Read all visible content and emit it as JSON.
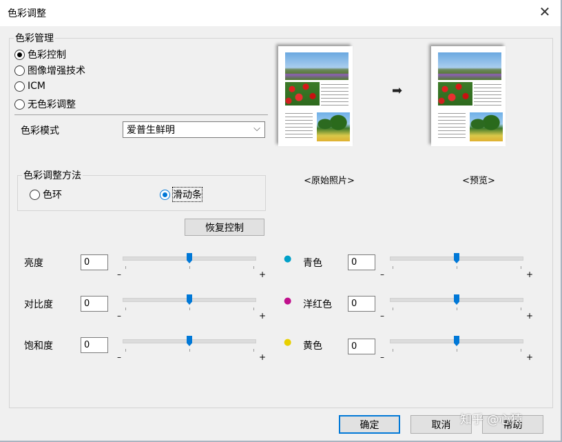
{
  "window": {
    "title": "色彩调整",
    "close_glyph": "✕"
  },
  "color_management": {
    "label": "色彩管理",
    "options": [
      {
        "label": "色彩控制",
        "checked": true
      },
      {
        "label": "图像增强技术",
        "checked": false
      },
      {
        "label": "ICM",
        "checked": false
      },
      {
        "label": "无色彩调整",
        "checked": false
      }
    ]
  },
  "color_mode": {
    "label": "色彩模式",
    "value": "爱普生鲜明",
    "chevron": "⌵"
  },
  "adjust_method": {
    "label": "色彩调整方法",
    "options": [
      {
        "label": "色环",
        "checked": false
      },
      {
        "label": "滑动条",
        "checked": true
      }
    ]
  },
  "preview": {
    "original_caption": "<原始照片>",
    "preview_caption": "<预览>",
    "arrow_glyph": "➡"
  },
  "restore_button": "恢复控制",
  "sliders_left": [
    {
      "label": "亮度",
      "value": "0",
      "level": 0
    },
    {
      "label": "对比度",
      "value": "0",
      "level": 0
    },
    {
      "label": "饱和度",
      "value": "0",
      "level": 0
    }
  ],
  "sliders_right": [
    {
      "label": "青色",
      "value": "0",
      "level": 0,
      "icon": "cyan-drop-icon",
      "color": "#00a0c8"
    },
    {
      "label": "洋红色",
      "value": "0",
      "level": 0,
      "icon": "magenta-drop-icon",
      "color": "#c0108c"
    },
    {
      "label": "黄色",
      "value": "0",
      "level": 0,
      "icon": "yellow-drop-icon",
      "color": "#e8d000"
    }
  ],
  "slider_min": "–",
  "slider_max": "+",
  "footer": {
    "ok": "确定",
    "cancel": "取消",
    "help": "帮助"
  },
  "watermark": "知乎 @心猿"
}
